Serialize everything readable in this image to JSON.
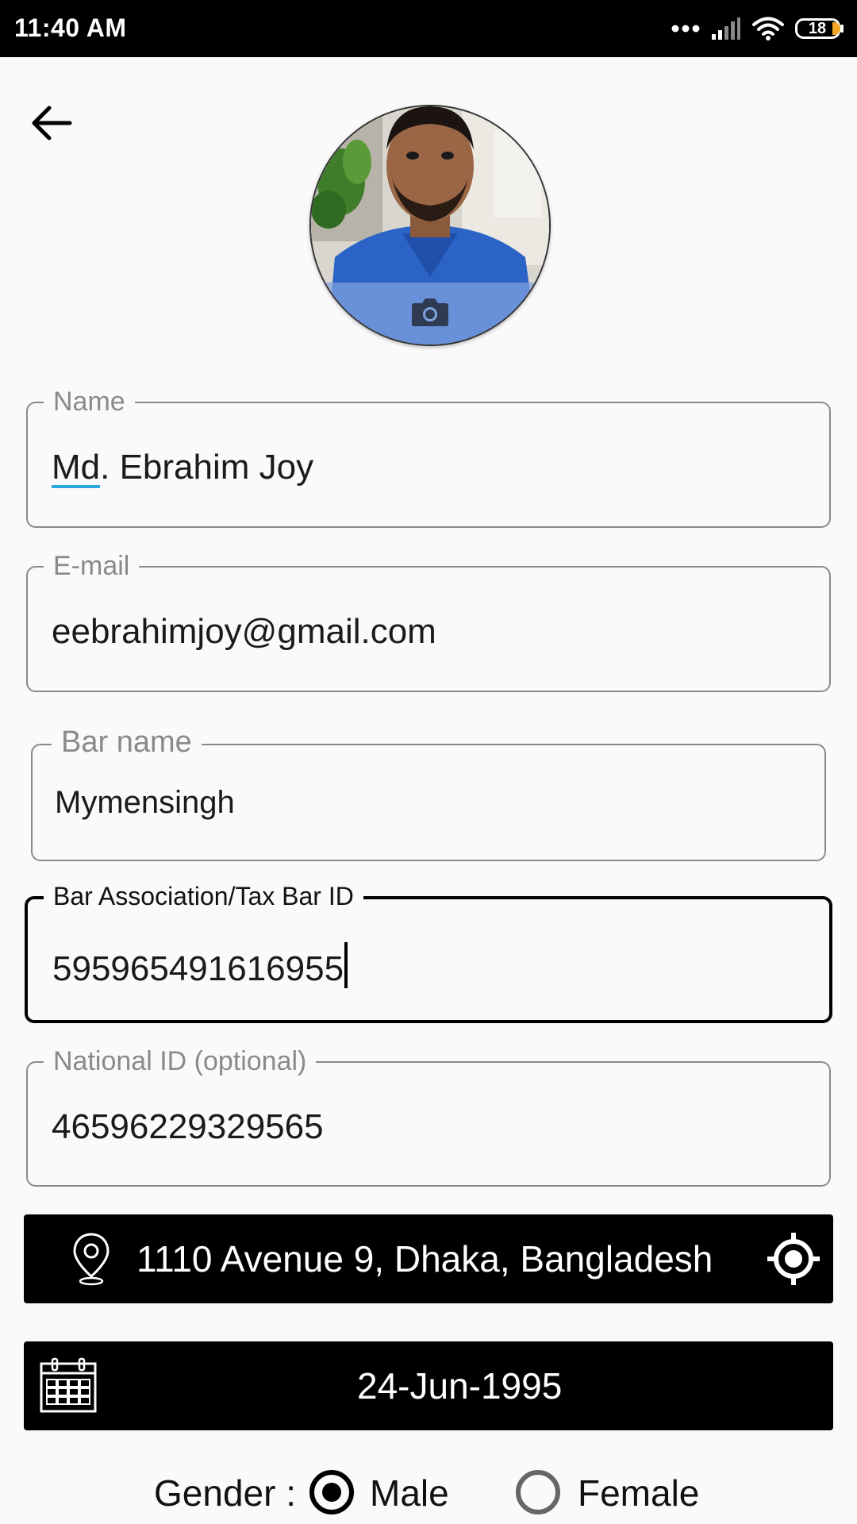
{
  "status_bar": {
    "time": "11:40 AM",
    "battery": "18"
  },
  "form": {
    "name": {
      "label": "Name",
      "value": "Md. Ebrahim Joy",
      "underlined_part": "Md",
      "rest": ". Ebrahim Joy"
    },
    "email": {
      "label": "E-mail",
      "value": "eebrahimjoy@gmail.com"
    },
    "bar_name": {
      "label": "Bar name",
      "value": "Mymensingh"
    },
    "bar_id": {
      "label": "Bar Association/Tax Bar ID",
      "value": "595965491616955"
    },
    "national_id": {
      "label": "National ID (optional)",
      "value": "46596229329565"
    }
  },
  "location": {
    "address": "1110 Avenue 9, Dhaka, Bangladesh"
  },
  "dob": {
    "date": "24-Jun-1995"
  },
  "gender": {
    "label": "Gender :",
    "options": [
      {
        "label": "Male",
        "selected": true
      },
      {
        "label": "Female",
        "selected": false
      }
    ]
  },
  "colors": {
    "status_bar_bg": "#000000",
    "page_bg": "#fafafa",
    "field_border": "#8a8a8a",
    "focused_border": "#000000",
    "spell_underline": "#29a8e0",
    "action_bar_bg": "#000000"
  },
  "icons": {
    "back": "arrow-left-icon",
    "camera": "camera-icon",
    "location_pin": "map-pin-icon",
    "gps": "crosshair-icon",
    "calendar": "calendar-icon"
  }
}
